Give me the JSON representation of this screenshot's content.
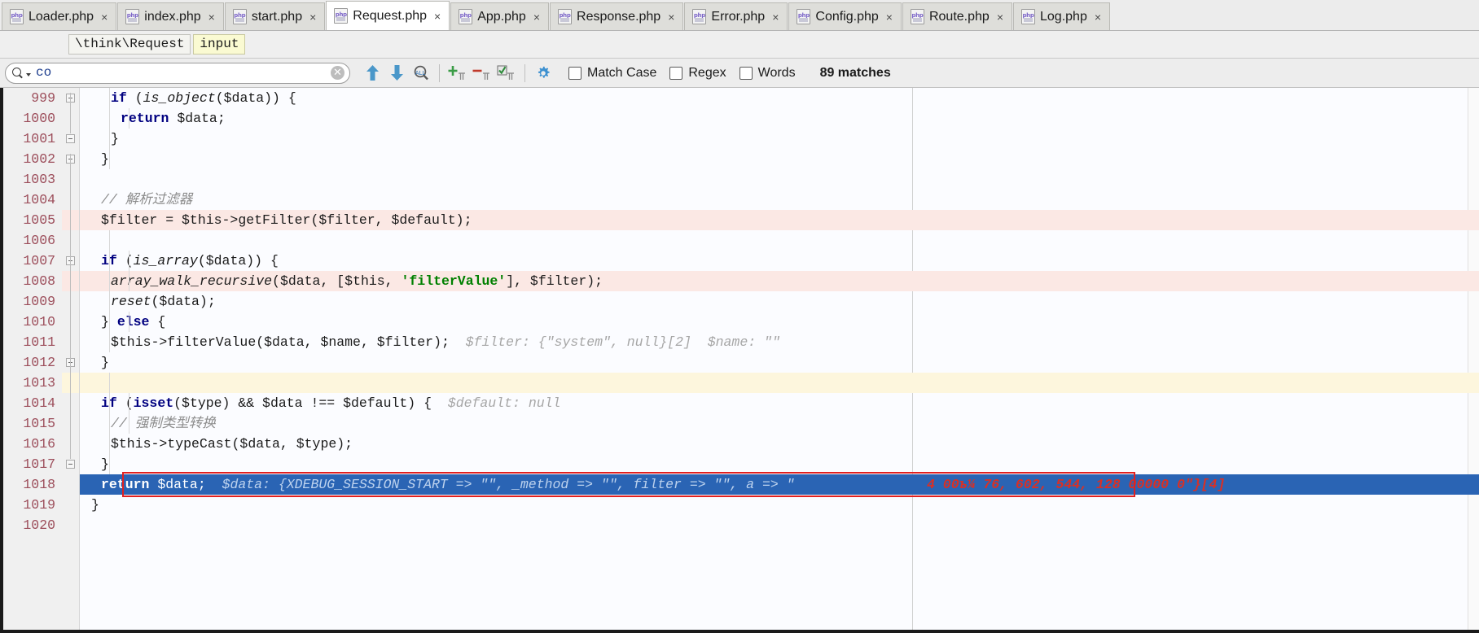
{
  "window": {
    "app": "PhpStorm Editor"
  },
  "tabs": [
    {
      "label": "Loader.php",
      "icon": "php-file-icon",
      "close": "×",
      "active": false
    },
    {
      "label": "index.php",
      "icon": "php-file-icon",
      "close": "×",
      "active": false
    },
    {
      "label": "start.php",
      "icon": "php-file-icon",
      "close": "×",
      "active": false
    },
    {
      "label": "Request.php",
      "icon": "php-file-icon",
      "close": "×",
      "active": true
    },
    {
      "label": "App.php",
      "icon": "php-file-icon",
      "close": "×",
      "active": false
    },
    {
      "label": "Response.php",
      "icon": "php-file-icon",
      "close": "×",
      "active": false
    },
    {
      "label": "Error.php",
      "icon": "php-file-icon",
      "close": "×",
      "active": false
    },
    {
      "label": "Config.php",
      "icon": "php-file-icon",
      "close": "×",
      "active": false
    },
    {
      "label": "Route.php",
      "icon": "php-file-icon",
      "close": "×",
      "active": false
    },
    {
      "label": "Log.php",
      "icon": "php-file-icon",
      "close": "×",
      "active": false
    }
  ],
  "breadcrumb": {
    "class": "\\think\\Request",
    "method": "input"
  },
  "find": {
    "query": "co",
    "placeholder": "",
    "magnifier_icon": "search-icon",
    "dropdown_icon": "chevron-down-icon",
    "clear_icon": "clear-circle-icon",
    "matches": "89 matches",
    "buttons": [
      {
        "name": "find-previous",
        "icon": "arrow-up-icon"
      },
      {
        "name": "find-next",
        "icon": "arrow-down-icon"
      },
      {
        "name": "find-all",
        "icon": "magnifier-all-icon"
      },
      {
        "name": "add-occurrence",
        "icon": "plus-occurrence-icon"
      },
      {
        "name": "remove-occurrence",
        "icon": "minus-occurrence-icon"
      },
      {
        "name": "select-all-occurrences",
        "icon": "select-all-occurrences-icon"
      },
      {
        "name": "find-settings",
        "icon": "gear-icon"
      }
    ],
    "options": [
      {
        "label": "Match Case",
        "checked": false
      },
      {
        "label": "Regex",
        "checked": false
      },
      {
        "label": "Words",
        "checked": false
      }
    ]
  },
  "editor": {
    "first_partial_line": "998",
    "lines": [
      {
        "num": "999",
        "indent": 24,
        "bg": "none",
        "breakpoint": false,
        "tokens": [
          {
            "t": "if",
            "c": "kw"
          },
          {
            "t": " (",
            "c": "var"
          },
          {
            "t": "is_object",
            "c": "fn"
          },
          {
            "t": "($data)) {",
            "c": "var"
          }
        ]
      },
      {
        "num": "1000",
        "indent": 36,
        "bg": "none",
        "breakpoint": false,
        "tokens": [
          {
            "t": "return",
            "c": "kw"
          },
          {
            "t": " $data;",
            "c": "var"
          }
        ]
      },
      {
        "num": "1001",
        "indent": 24,
        "bg": "none",
        "breakpoint": false,
        "tokens": [
          {
            "t": "}",
            "c": "var"
          }
        ]
      },
      {
        "num": "1002",
        "indent": 12,
        "bg": "none",
        "breakpoint": false,
        "tokens": [
          {
            "t": "}",
            "c": "var"
          }
        ]
      },
      {
        "num": "1003",
        "indent": 0,
        "bg": "none",
        "breakpoint": false,
        "tokens": []
      },
      {
        "num": "1004",
        "indent": 12,
        "bg": "none",
        "breakpoint": false,
        "tokens": [
          {
            "t": "// 解析过滤器",
            "c": "cmt"
          }
        ]
      },
      {
        "num": "1005",
        "indent": 12,
        "bg": "bp",
        "breakpoint": true,
        "tokens": [
          {
            "t": "$filter = $this->getFilter($filter, $default);",
            "c": "var"
          }
        ]
      },
      {
        "num": "1006",
        "indent": 0,
        "bg": "none",
        "breakpoint": false,
        "tokens": []
      },
      {
        "num": "1007",
        "indent": 12,
        "bg": "none",
        "breakpoint": false,
        "tokens": [
          {
            "t": "if",
            "c": "kw"
          },
          {
            "t": " (",
            "c": "var"
          },
          {
            "t": "is_array",
            "c": "fn"
          },
          {
            "t": "($data)) {",
            "c": "var"
          }
        ]
      },
      {
        "num": "1008",
        "indent": 24,
        "bg": "bp",
        "breakpoint": true,
        "tokens": [
          {
            "t": "array_walk_recursive",
            "c": "fn"
          },
          {
            "t": "($data, [$this, ",
            "c": "var"
          },
          {
            "t": "'filterValue'",
            "c": "str"
          },
          {
            "t": "], $filter);",
            "c": "var"
          }
        ]
      },
      {
        "num": "1009",
        "indent": 24,
        "bg": "none",
        "breakpoint": false,
        "tokens": [
          {
            "t": "reset",
            "c": "fn"
          },
          {
            "t": "($data);",
            "c": "var"
          }
        ]
      },
      {
        "num": "1010",
        "indent": 12,
        "bg": "none",
        "breakpoint": false,
        "tokens": [
          {
            "t": "} ",
            "c": "var"
          },
          {
            "t": "else",
            "c": "kw"
          },
          {
            "t": " {",
            "c": "var"
          }
        ]
      },
      {
        "num": "1011",
        "indent": 24,
        "bg": "none",
        "breakpoint": false,
        "tokens": [
          {
            "t": "$this->filterValue($data, $name, $filter);",
            "c": "var"
          },
          {
            "t": "  $filter: {\"system\", null}[2]  $name: \"\"",
            "c": "hint"
          }
        ]
      },
      {
        "num": "1012",
        "indent": 12,
        "bg": "none",
        "breakpoint": false,
        "tokens": [
          {
            "t": "}",
            "c": "var"
          }
        ]
      },
      {
        "num": "1013",
        "indent": 0,
        "bg": "warn",
        "breakpoint": false,
        "tokens": []
      },
      {
        "num": "1014",
        "indent": 12,
        "bg": "none",
        "breakpoint": false,
        "tokens": [
          {
            "t": "if",
            "c": "kw"
          },
          {
            "t": " (",
            "c": "var"
          },
          {
            "t": "isset",
            "c": "kw"
          },
          {
            "t": "($type) && $data !== $default) {",
            "c": "var"
          },
          {
            "t": "  $default: null",
            "c": "hint"
          }
        ]
      },
      {
        "num": "1015",
        "indent": 24,
        "bg": "none",
        "breakpoint": false,
        "tokens": [
          {
            "t": "// 强制类型转换",
            "c": "cmt"
          }
        ]
      },
      {
        "num": "1016",
        "indent": 24,
        "bg": "none",
        "breakpoint": false,
        "tokens": [
          {
            "t": "$this->typeCast($data, $type);",
            "c": "var"
          }
        ]
      },
      {
        "num": "1017",
        "indent": 12,
        "bg": "none",
        "breakpoint": false,
        "tokens": [
          {
            "t": "}",
            "c": "var"
          }
        ]
      },
      {
        "num": "1018",
        "indent": 12,
        "bg": "sel",
        "breakpoint": false,
        "selected": true,
        "tokens": [
          {
            "t": "return",
            "c": "kw-sel"
          },
          {
            "t": " $data;",
            "c": "sel-txt"
          },
          {
            "t": "  $data: {XDEBUG_SESSION_START => \"\", _method => \"\", filter => \"\", a => \"",
            "c": "sel-hint"
          }
        ],
        "tail_hint": "4 00ъ¼ 76, 602, 544, 128 00000 0\"}[4]"
      },
      {
        "num": "1019",
        "indent": 0,
        "bg": "none",
        "breakpoint": false,
        "tokens": [
          {
            "t": "}",
            "c": "var"
          }
        ]
      },
      {
        "num": "1020",
        "indent": 0,
        "bg": "none",
        "breakpoint": false,
        "tokens": []
      }
    ],
    "annotation": {
      "type": "red-rectangle",
      "target_line": "1018"
    }
  }
}
